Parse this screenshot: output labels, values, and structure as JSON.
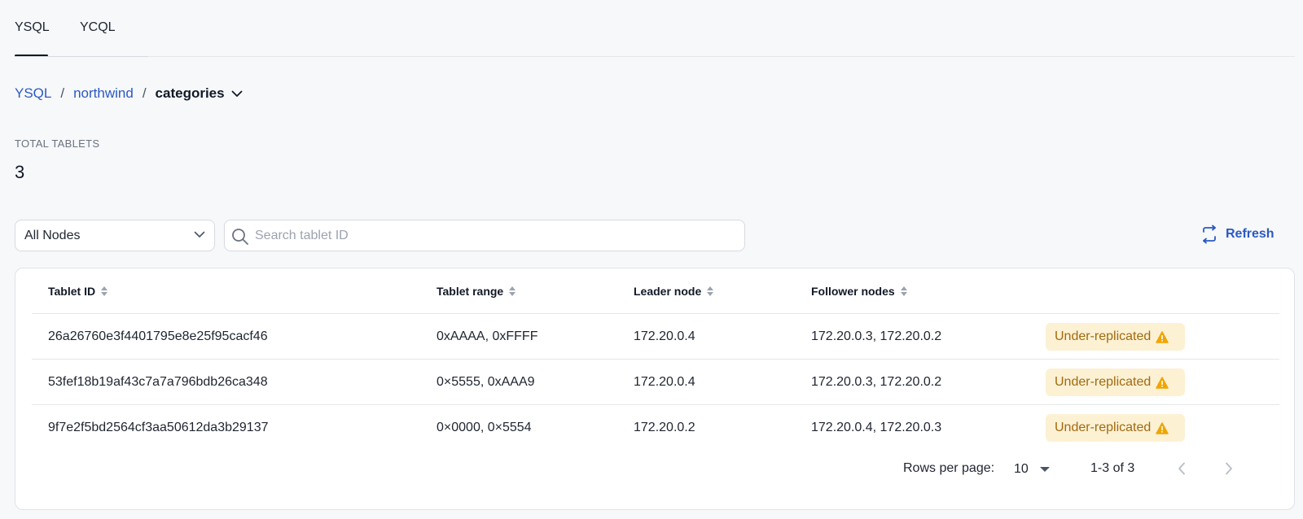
{
  "tabs": [
    {
      "label": "YSQL",
      "active": true
    },
    {
      "label": "YCQL",
      "active": false
    }
  ],
  "breadcrumb": {
    "items": [
      "YSQL",
      "northwind"
    ],
    "current": "categories",
    "separator": "/"
  },
  "summary": {
    "label": "TOTAL TABLETS",
    "value": "3"
  },
  "filters": {
    "node_select_value": "All Nodes",
    "search_placeholder": "Search tablet ID",
    "search_value": ""
  },
  "refresh_label": "Refresh",
  "table": {
    "columns": [
      "Tablet ID",
      "Tablet range",
      "Leader node",
      "Follower nodes"
    ],
    "rows": [
      {
        "tablet_id": "26a26760e3f4401795e8e25f95cacf46",
        "range": "0xAAAA, 0xFFFF",
        "leader": "172.20.0.4",
        "followers": "172.20.0.3, 172.20.0.2",
        "status": "Under-replicated"
      },
      {
        "tablet_id": "53fef18b19af43c7a7a796bdb26ca348",
        "range": "0×5555, 0xAAA9",
        "leader": "172.20.0.4",
        "followers": "172.20.0.3, 172.20.0.2",
        "status": "Under-replicated"
      },
      {
        "tablet_id": "9f7e2f5bd2564cf3aa50612da3b29137",
        "range": "0×0000, 0×5554",
        "leader": "172.20.0.2",
        "followers": "172.20.0.4, 172.20.0.3",
        "status": "Under-replicated"
      }
    ]
  },
  "pagination": {
    "rows_per_page_label": "Rows per page:",
    "rows_per_page": "10",
    "range_text": "1-3 of 3"
  },
  "colors": {
    "link": "#2b59c3",
    "badge_bg": "#fdf1d4",
    "badge_text": "#a06a10",
    "warning_icon": "#f0a500"
  }
}
